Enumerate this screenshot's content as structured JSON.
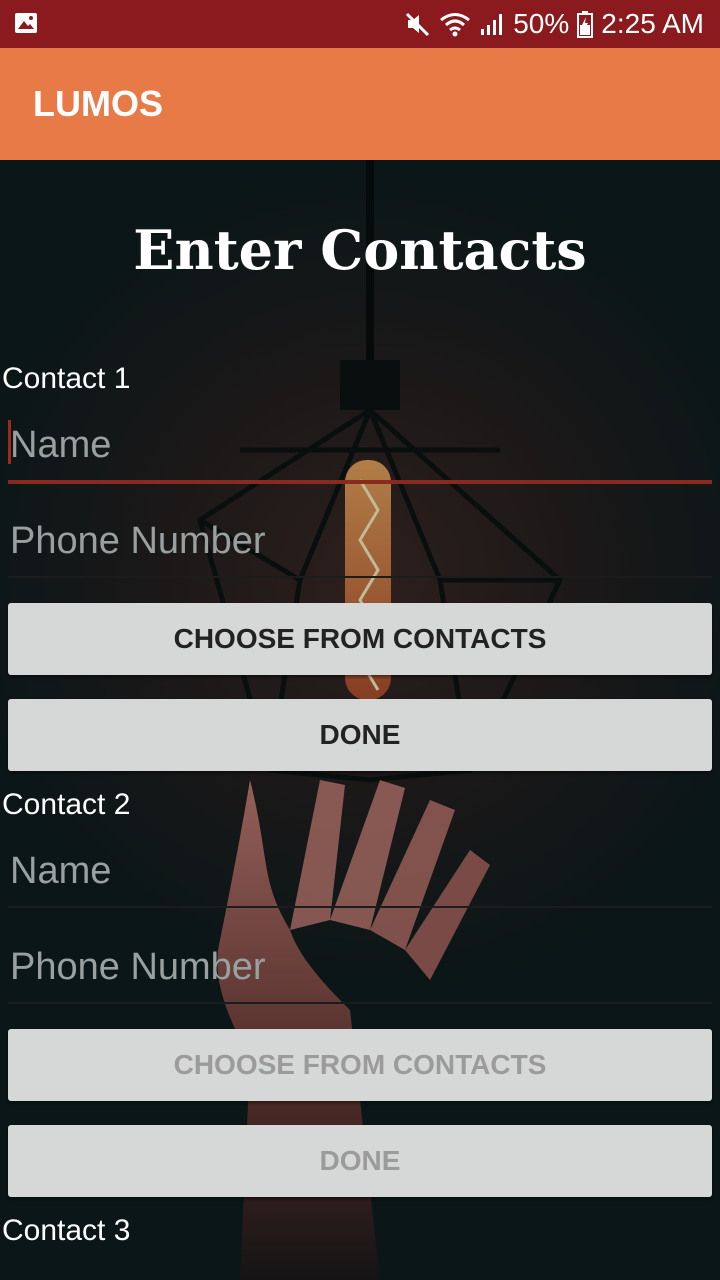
{
  "status_bar": {
    "battery": "50%",
    "time": "2:25 AM",
    "icons": [
      "gallery-icon",
      "mute-icon",
      "wifi-icon",
      "signal-icon",
      "battery-icon"
    ]
  },
  "app_bar": {
    "title": "LUMOS",
    "color": "#e87a47"
  },
  "colors": {
    "status_bar": "#8a1a1d",
    "button_bg": "#d6d7d7",
    "active_underline": "#8a2a1e"
  },
  "page": {
    "heading": "Enter Contacts"
  },
  "contacts": [
    {
      "label": "Contact 1",
      "name_placeholder": "Name",
      "phone_placeholder": "Phone Number",
      "choose_label": "CHOOSE FROM CONTACTS",
      "done_label": "DONE",
      "enabled": true
    },
    {
      "label": "Contact 2",
      "name_placeholder": "Name",
      "phone_placeholder": "Phone Number",
      "choose_label": "CHOOSE FROM CONTACTS",
      "done_label": "DONE",
      "enabled": false
    },
    {
      "label": "Contact 3"
    }
  ]
}
